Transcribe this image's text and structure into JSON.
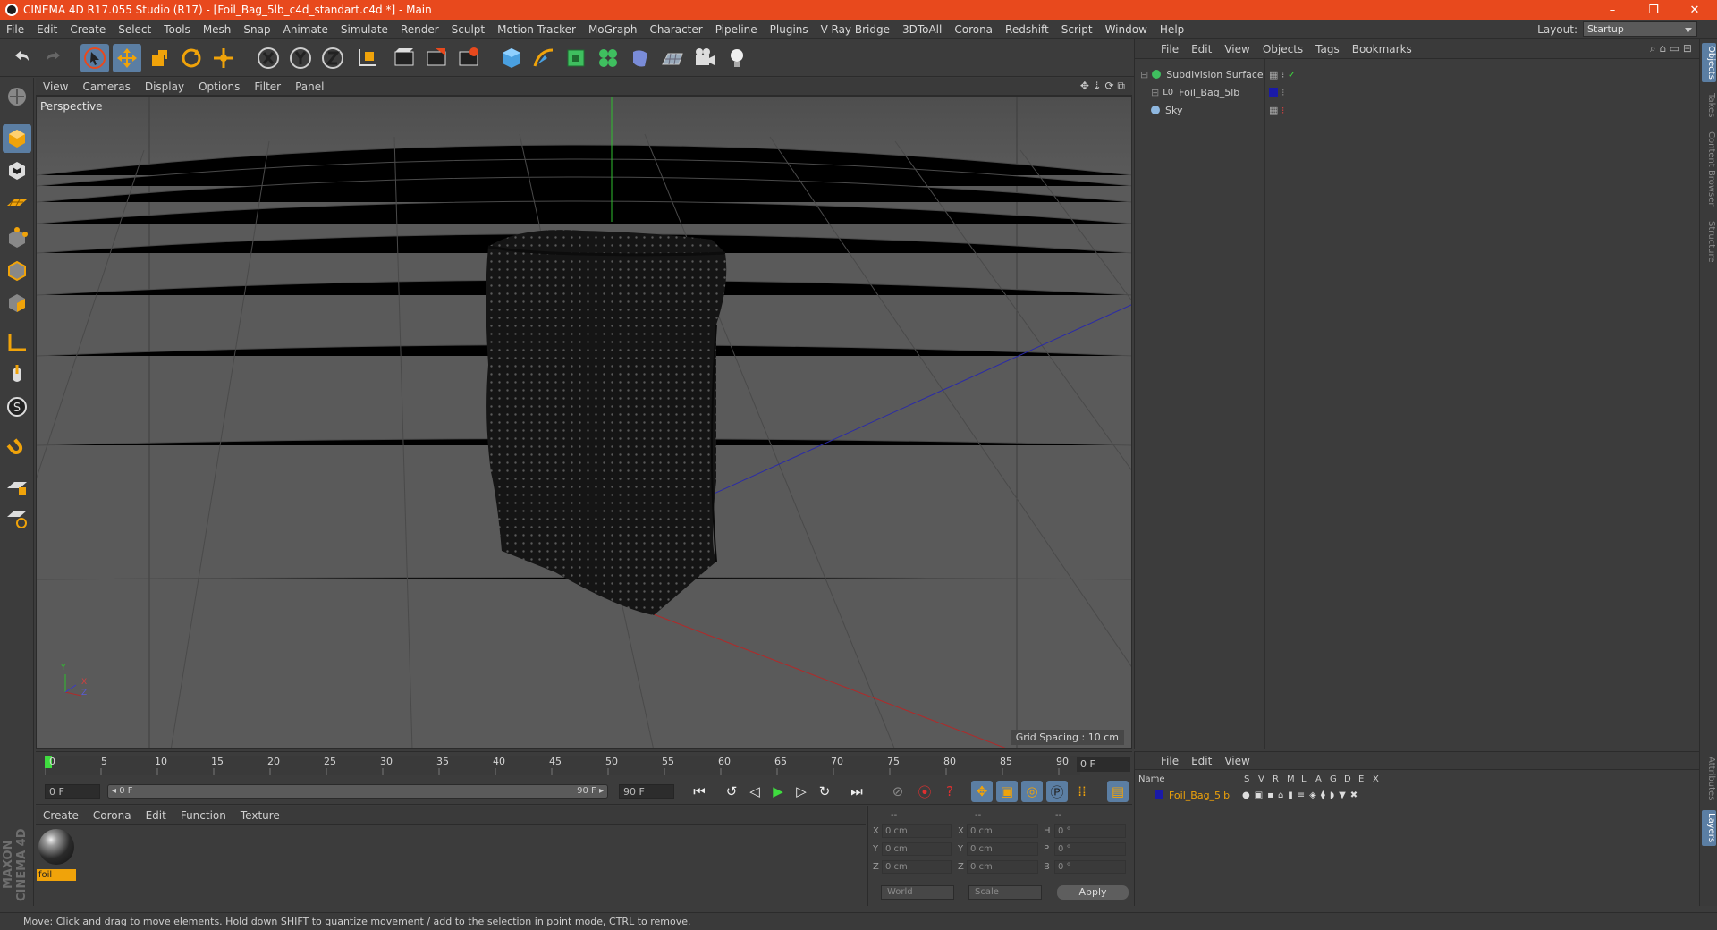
{
  "window": {
    "title": "CINEMA 4D R17.055 Studio (R17) - [Foil_Bag_5lb_c4d_standart.c4d *] - Main",
    "controls": [
      "–",
      "❐",
      "✕"
    ]
  },
  "menu": [
    "File",
    "Edit",
    "Create",
    "Select",
    "Tools",
    "Mesh",
    "Snap",
    "Animate",
    "Simulate",
    "Render",
    "Sculpt",
    "Motion Tracker",
    "MoGraph",
    "Character",
    "Pipeline",
    "Plugins",
    "V-Ray Bridge",
    "3DToAll",
    "Corona",
    "Redshift",
    "Script",
    "Window",
    "Help"
  ],
  "layout": {
    "label": "Layout:",
    "value": "Startup"
  },
  "viewport": {
    "menu": [
      "View",
      "Cameras",
      "Display",
      "Options",
      "Filter",
      "Panel"
    ],
    "camera_label": "Perspective",
    "grid_spacing": "Grid Spacing : 10 cm",
    "axis_labels": {
      "y": "Y",
      "x": "X",
      "z": "Z"
    }
  },
  "timeline": {
    "ticks": [
      "0",
      "5",
      "10",
      "15",
      "20",
      "25",
      "30",
      "35",
      "40",
      "45",
      "50",
      "55",
      "60",
      "65",
      "70",
      "75",
      "80",
      "85",
      "90"
    ],
    "current_frame": "0 F",
    "start_field": "0 F",
    "range_start": "◂ 0 F",
    "range_end": "90 F ▸",
    "end_field": "90 F"
  },
  "materials": {
    "menu": [
      "Create",
      "Corona",
      "Edit",
      "Function",
      "Texture"
    ],
    "items": [
      {
        "name": "foil"
      }
    ]
  },
  "coords": {
    "headers": [
      "--",
      "--",
      "--"
    ],
    "rows": [
      {
        "a": "X",
        "av": "0 cm",
        "b": "X",
        "bv": "0 cm",
        "c": "H",
        "cv": "0 °"
      },
      {
        "a": "Y",
        "av": "0 cm",
        "b": "Y",
        "bv": "0 cm",
        "c": "P",
        "cv": "0 °"
      },
      {
        "a": "Z",
        "av": "0 cm",
        "b": "Z",
        "bv": "0 cm",
        "c": "B",
        "cv": "0 °"
      }
    ],
    "mode": "World",
    "scale": "Scale",
    "apply": "Apply"
  },
  "objects": {
    "menu": [
      "File",
      "Edit",
      "View",
      "Objects",
      "Tags",
      "Bookmarks"
    ],
    "items": [
      {
        "name": "Subdivision Surface"
      },
      {
        "name": "Foil_Bag_5lb"
      },
      {
        "name": "Sky"
      }
    ]
  },
  "layers": {
    "menu": [
      "File",
      "Edit",
      "View"
    ],
    "columns": [
      "Name",
      "S",
      "V",
      "R",
      "M",
      "L",
      "A",
      "G",
      "D",
      "E",
      "X"
    ],
    "items": [
      {
        "name": "Foil_Bag_5lb"
      }
    ]
  },
  "side_tabs": [
    "Objects",
    "Takes",
    "Content Browser",
    "Structure",
    "Attributes",
    "Layers"
  ],
  "status": "Move: Click and drag to move elements. Hold down SHIFT to quantize movement / add to the selection in point mode, CTRL to remove.",
  "maxon": "MAXON CINEMA 4D",
  "colors": {
    "titlebar": "#e8491d",
    "highlight": "#5b7ea3",
    "material_tag": "#f0a30a",
    "layer_color": "#1a1aa8"
  }
}
